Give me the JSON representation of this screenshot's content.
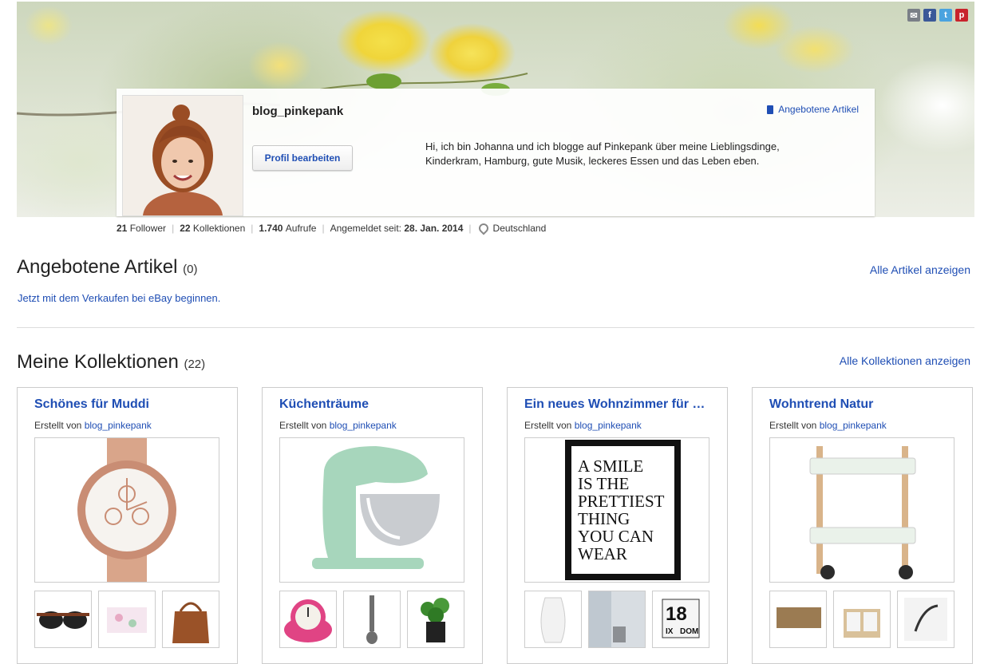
{
  "profile": {
    "username": "blog_pinkepank",
    "edit_button": "Profil bearbeiten",
    "bio": "Hi, ich bin Johanna und ich blogge auf Pinkepank über meine Lieblingsdinge, Kinderkram, Hamburg, gute Musik, leckeres Essen und das Leben eben.",
    "offered_link": "Angebotene Artikel"
  },
  "social": {
    "mail": "✉",
    "facebook": "f",
    "twitter": "t",
    "pinterest": "p"
  },
  "stats": {
    "followers_count": "21",
    "followers_label": "Follower",
    "collections_count": "22",
    "collections_label": "Kollektionen",
    "views_count": "1.740",
    "views_label": "Aufrufe",
    "registered_label": "Angemeldet seit:",
    "registered_date": "28. Jan. 2014",
    "location": "Deutschland"
  },
  "offered": {
    "title": "Angebotene Artikel",
    "count": "(0)",
    "all_link": "Alle Artikel anzeigen",
    "sell_link": "Jetzt mit dem Verkaufen bei eBay beginnen."
  },
  "collections": {
    "title": "Meine Kollektionen",
    "count": "(22)",
    "all_link": "Alle Kollektionen anzeigen",
    "created_by_label": "Erstellt von",
    "items": [
      {
        "title": "Schönes für Muddi",
        "author": "blog_pinkepank"
      },
      {
        "title": "Küchenträume",
        "author": "blog_pinkepank"
      },
      {
        "title": "Ein neues Wohnzimmer für …",
        "author": "blog_pinkepank"
      },
      {
        "title": "Wohntrend Natur",
        "author": "blog_pinkepank"
      }
    ]
  },
  "poster_text": [
    "A SMILE",
    "IS THE",
    "PRETTIEST",
    "THING",
    "YOU CAN",
    "WEAR"
  ],
  "calendar_text": {
    "day": "18",
    "weekday": "DOM",
    "month": "IX"
  },
  "colors": {
    "link": "#1f4eb4",
    "text": "#333333",
    "divider": "#dddddd"
  }
}
